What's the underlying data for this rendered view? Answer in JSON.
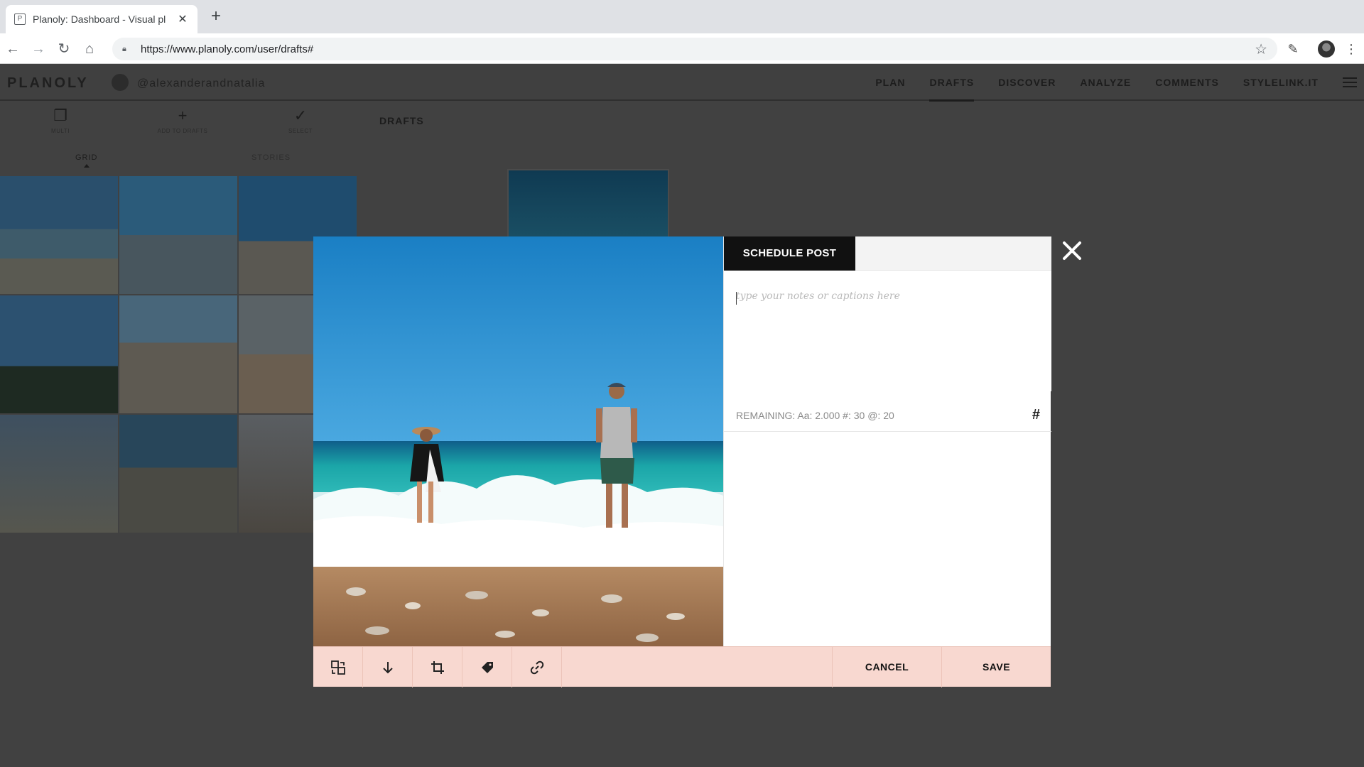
{
  "browser": {
    "tab_title": "Planoly: Dashboard - Visual pl",
    "tab_favicon": "P",
    "tab_close": "✕",
    "new_tab": "+",
    "url": "https://www.planoly.com/user/drafts#"
  },
  "app": {
    "logo": "PLANOLY",
    "account": "@alexanderandnatalia",
    "nav": [
      {
        "label": "PLAN"
      },
      {
        "label": "DRAFTS"
      },
      {
        "label": "DISCOVER"
      },
      {
        "label": "ANALYZE"
      },
      {
        "label": "COMMENTS"
      },
      {
        "label": "STYLELINK.IT"
      }
    ],
    "active_nav": "DRAFTS",
    "subtools": [
      {
        "label": "MULTI",
        "icon": "multi-icon"
      },
      {
        "label": "ADD TO DRAFTS",
        "icon": "plus-icon"
      },
      {
        "label": "SELECT",
        "icon": "check-icon"
      }
    ],
    "drafts_heading": "DRAFTS",
    "grid_tabs": [
      {
        "label": "GRID"
      },
      {
        "label": "STORIES"
      }
    ],
    "active_grid_tab": "GRID"
  },
  "modal": {
    "tab_label": "SCHEDULE POST",
    "caption_placeholder": "type your notes or captions here",
    "remaining": "REMAINING: Aa: 2.000   #: 30   @: 20",
    "hashtag_button": "#",
    "cancel_label": "CANCEL",
    "save_label": "SAVE",
    "tools": [
      {
        "icon": "swap-media-icon"
      },
      {
        "icon": "download-icon"
      },
      {
        "icon": "crop-icon"
      },
      {
        "icon": "tag-icon"
      },
      {
        "icon": "link-icon"
      }
    ]
  },
  "colors": {
    "overlay": "#3a3a3a",
    "footer": "#f8d8d0",
    "tab_active": "#111111"
  }
}
